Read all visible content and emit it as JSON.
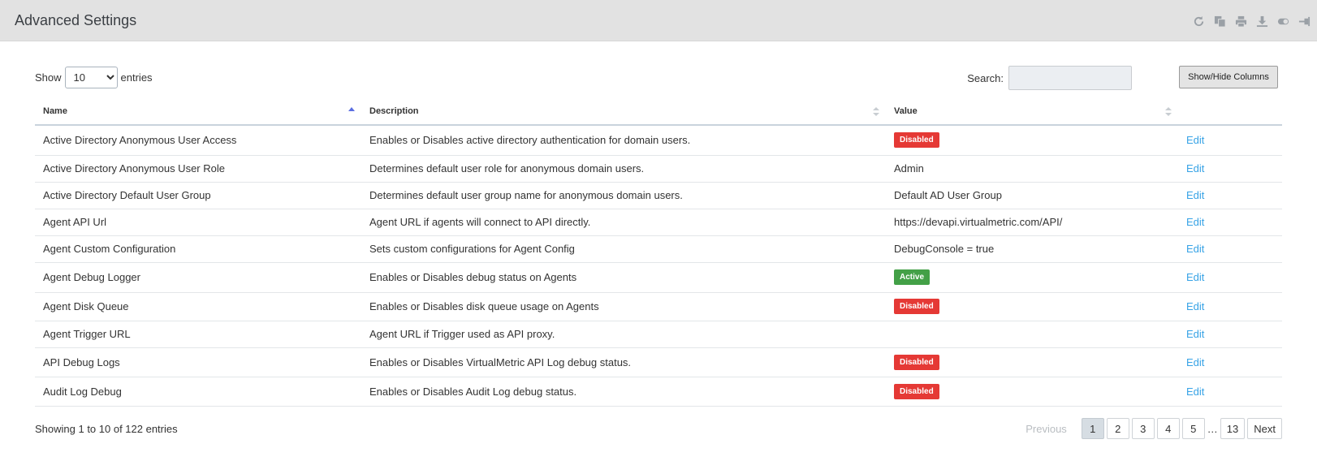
{
  "header": {
    "title": "Advanced Settings",
    "tools": [
      "refresh-icon",
      "copy-icon",
      "print-icon",
      "download-icon",
      "toggle-icon",
      "pin-icon"
    ]
  },
  "length": {
    "label_before": "Show",
    "value": "10",
    "label_after": "entries"
  },
  "search": {
    "label": "Search:",
    "value": ""
  },
  "colvis": {
    "label": "Show/Hide Columns"
  },
  "table": {
    "columns": [
      "Name",
      "Description",
      "Value"
    ],
    "rows": [
      {
        "name": "Active Directory Anonymous User Access",
        "description": "Enables or Disables active directory authentication for domain users.",
        "value": "Disabled",
        "value_type": "badge-disabled",
        "action": "Edit"
      },
      {
        "name": "Active Directory Anonymous User Role",
        "description": "Determines default user role for anonymous domain users.",
        "value": "Admin",
        "value_type": "text",
        "action": "Edit"
      },
      {
        "name": "Active Directory Default User Group",
        "description": "Determines default user group name for anonymous domain users.",
        "value": "Default AD User Group",
        "value_type": "text",
        "action": "Edit"
      },
      {
        "name": "Agent API Url",
        "description": "Agent URL if agents will connect to API directly.",
        "value": "https://devapi.virtualmetric.com/API/",
        "value_type": "text",
        "action": "Edit"
      },
      {
        "name": "Agent Custom Configuration",
        "description": "Sets custom configurations for Agent Config",
        "value": "DebugConsole = true",
        "value_type": "text",
        "action": "Edit"
      },
      {
        "name": "Agent Debug Logger",
        "description": "Enables or Disables debug status on Agents",
        "value": "Active",
        "value_type": "badge-active",
        "action": "Edit"
      },
      {
        "name": "Agent Disk Queue",
        "description": "Enables or Disables disk queue usage on Agents",
        "value": "Disabled",
        "value_type": "badge-disabled",
        "action": "Edit"
      },
      {
        "name": "Agent Trigger URL",
        "description": "Agent URL if Trigger used as API proxy.",
        "value": "",
        "value_type": "text",
        "action": "Edit"
      },
      {
        "name": "API Debug Logs",
        "description": "Enables or Disables VirtualMetric API Log debug status.",
        "value": "Disabled",
        "value_type": "badge-disabled",
        "action": "Edit"
      },
      {
        "name": "Audit Log Debug",
        "description": "Enables or Disables Audit Log debug status.",
        "value": "Disabled",
        "value_type": "badge-disabled",
        "action": "Edit"
      }
    ]
  },
  "info": "Showing 1 to 10 of 122 entries",
  "pagination": {
    "previous": "Previous",
    "pages": [
      "1",
      "2",
      "3",
      "4",
      "5"
    ],
    "ellipsis": "…",
    "last": "13",
    "next": "Next",
    "current": "1"
  },
  "colors": {
    "header_bg": "#e2e2e2",
    "disabled_badge": "#e53935",
    "active_badge": "#43a047",
    "link": "#37a3e6",
    "sort_active": "#5b6ee1"
  }
}
